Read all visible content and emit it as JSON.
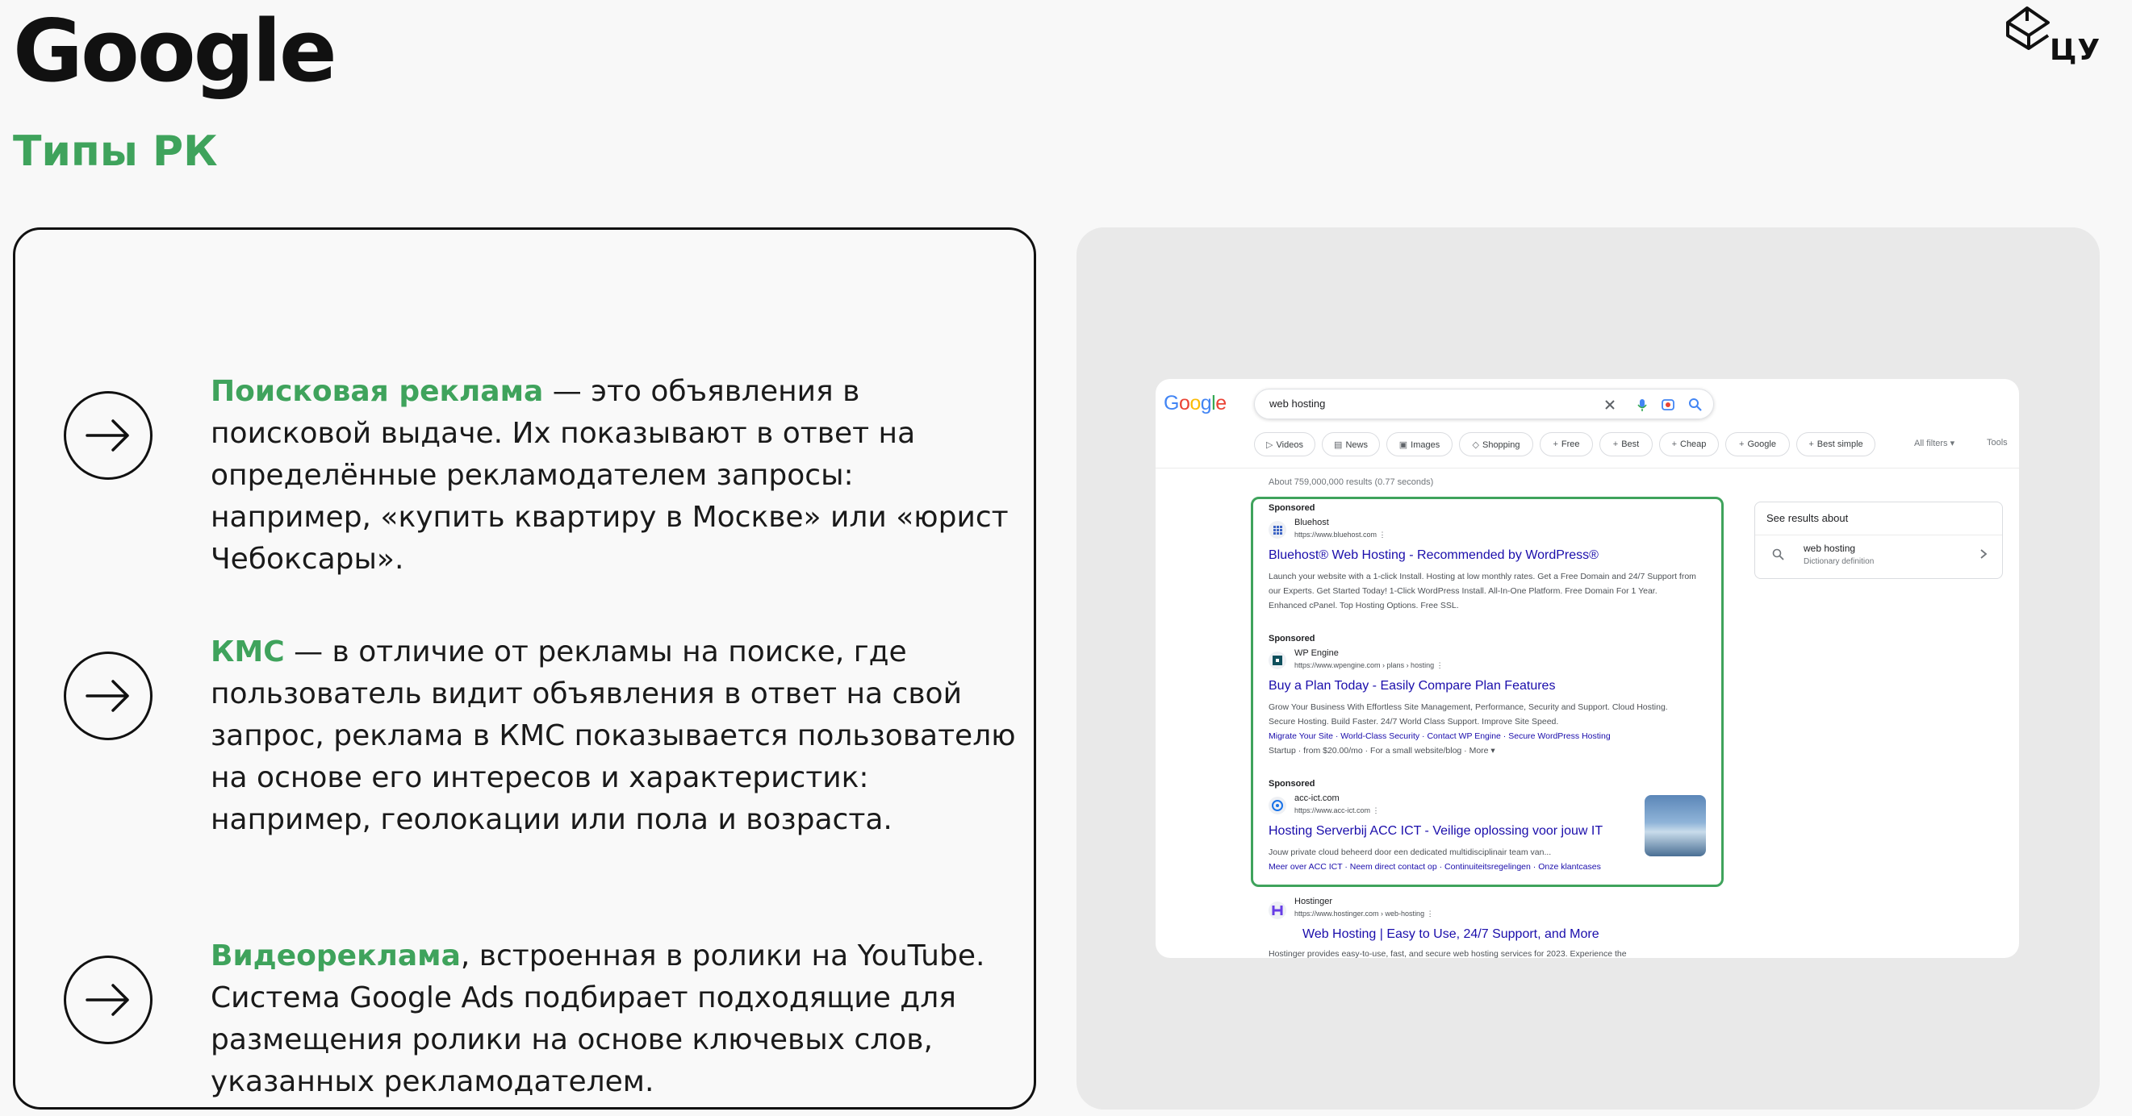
{
  "header": {
    "title": "Google",
    "subtitle": "Типы РК",
    "logo_text": "ЦУ"
  },
  "items": [
    {
      "icon": "arrow-right-icon",
      "highlight": "Поисковая реклама",
      "text": " — это объявления в поисковой выдаче. Их показывают в ответ на определённые рекламодателем запросы: например, «купить квартиру в Москве» или «юрист Чебоксары»."
    },
    {
      "icon": "arrow-right-icon",
      "highlight": "КМС",
      "text": " — в отличие от рекламы на поиске, где пользователь видит объявления в ответ на свой запрос, реклама в КМС показывается пользователю на основе его интересов и характеристик: например, геолокации или пола и возраста."
    },
    {
      "icon": "arrow-right-icon",
      "highlight": "Видеореклама",
      "text": ", встроенная в ролики на YouTube. Система Google Ads подбирает подходящие для размещения ролики на основе ключевых слов, указанных рекламодателем."
    }
  ],
  "serp": {
    "logo_letters": [
      "G",
      "o",
      "o",
      "g",
      "l",
      "e"
    ],
    "query": "web hosting",
    "chips": [
      "Videos",
      "News",
      "Images",
      "Shopping",
      "Free",
      "Best",
      "Cheap",
      "Google",
      "Best simple"
    ],
    "all_filters": "All filters ▾",
    "tools": "Tools",
    "stats": "About 759,000,000 results (0.77 seconds)",
    "ads": [
      {
        "sponsored": "Sponsored",
        "site": "Bluehost",
        "url": "https://www.bluehost.com  ⋮",
        "title": "Bluehost® Web Hosting - Recommended by WordPress®",
        "desc": "Launch your website with a 1-click Install. Hosting at low monthly rates. Get a Free Domain and 24/7 Support from our Experts. Get Started Today! 1-Click WordPress Install. All-In-One Platform. Free Domain For 1 Year. Enhanced cPanel. Top Hosting Options. Free SSL."
      },
      {
        "sponsored": "Sponsored",
        "site": "WP Engine",
        "url": "https://www.wpengine.com › plans › hosting  ⋮",
        "title": "Buy a Plan Today - Easily Compare Plan Features",
        "desc": "Grow Your Business With Effortless Site Management, Performance, Security and Support. Cloud Hosting. Secure Hosting. Build Faster. 24/7 World Class Support. Improve Site Speed.",
        "sitelinks": "Migrate Your Site · World-Class Security · Contact WP Engine · Secure WordPress Hosting",
        "extra": "Startup · from $20.00/mo · For a small website/blog · More ▾"
      },
      {
        "sponsored": "Sponsored",
        "site": "acc-ict.com",
        "url": "https://www.acc-ict.com  ⋮",
        "title": "Hosting Serverbij ACC ICT - Veilige oplossing voor jouw IT",
        "desc": "Jouw private cloud beheerd door een dedicated multidisciplinair team van...",
        "sitelinks": "Meer over ACC ICT · Neem direct contact op · Continuiteitsregelingen · Onze klantcases"
      }
    ],
    "organic": {
      "site": "Hostinger",
      "url": "https://www.hostinger.com › web-hosting  ⋮",
      "title": "Web Hosting | Easy to Use, 24/7 Support, and More",
      "desc": "Hostinger provides easy-to-use, fast, and secure web hosting services for 2023. Experience the"
    },
    "knowledge": {
      "heading": "See results about",
      "term": "web hosting",
      "definition": "Dictionary definition"
    }
  },
  "colors": {
    "accent_green": "#3fa35c",
    "link_blue": "#1a0dab"
  }
}
